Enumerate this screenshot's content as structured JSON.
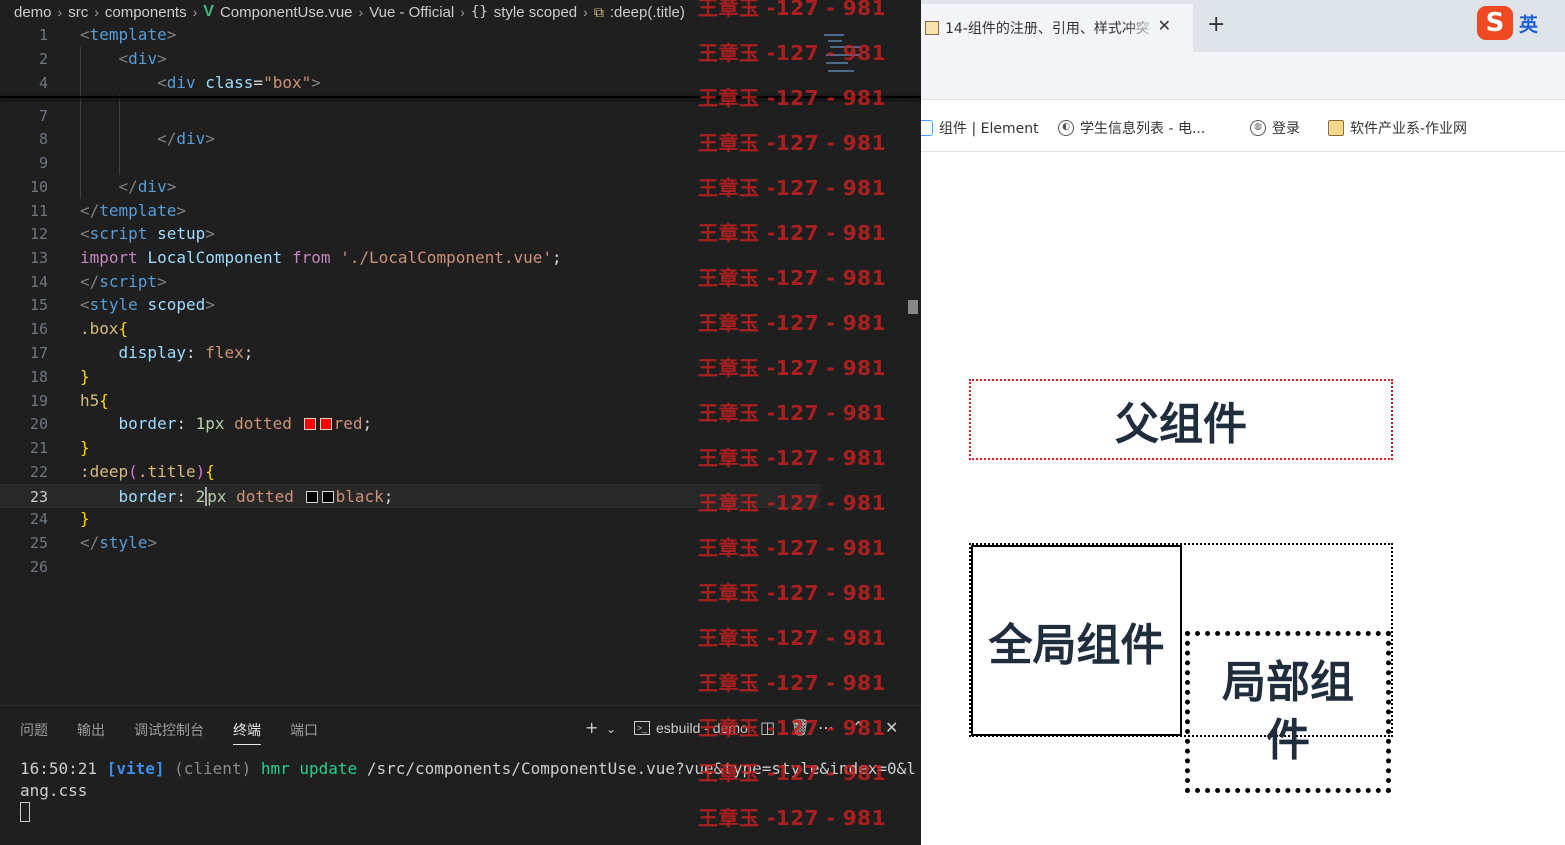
{
  "breadcrumb": [
    "demo",
    "src",
    "components",
    "ComponentUse.vue",
    "Vue - Official",
    "style scoped",
    ":deep(.title)"
  ],
  "code_lines": [
    {
      "n": "1",
      "html": "<span class='tag'>&lt;</span><span class='tn'>template</span><span class='tag'>&gt;</span>"
    },
    {
      "n": "2",
      "html": "    <span class='tag'>&lt;</span><span class='tn'>div</span><span class='tag'>&gt;</span>"
    },
    {
      "n": "4",
      "html": "        <span class='tag'>&lt;</span><span class='tn'>div</span> <span class='attr'>class</span>=<span class='str'>\"box\"</span><span class='tag'>&gt;</span>"
    },
    {
      "n": "7",
      "html": ""
    },
    {
      "n": "8",
      "html": "        <span class='tag'>&lt;/</span><span class='tn'>div</span><span class='tag'>&gt;</span>"
    },
    {
      "n": "9",
      "html": ""
    },
    {
      "n": "10",
      "html": "    <span class='tag'>&lt;/</span><span class='tn'>div</span><span class='tag'>&gt;</span>"
    },
    {
      "n": "11",
      "html": "<span class='tag'>&lt;/</span><span class='tn'>template</span><span class='tag'>&gt;</span>"
    },
    {
      "n": "12",
      "html": "<span class='tag'>&lt;</span><span class='tn'>script</span> <span class='attr'>setup</span><span class='tag'>&gt;</span>"
    },
    {
      "n": "13",
      "html": "<span class='kw'>import</span> <span class='id'>LocalComponent</span> <span class='kw'>from</span> <span class='str'>'./LocalComponent.vue'</span>;"
    },
    {
      "n": "14",
      "html": "<span class='tag'>&lt;/</span><span class='tn'>script</span><span class='tag'>&gt;</span>"
    },
    {
      "n": "15",
      "html": "<span class='tag'>&lt;</span><span class='tn'>style</span> <span class='attr'>scoped</span><span class='tag'>&gt;</span>"
    },
    {
      "n": "16",
      "html": "<span class='sel'>.box</span><span class='brace'>{</span>"
    },
    {
      "n": "17",
      "html": "    <span class='prop'>display</span>: <span class='val'>flex</span>;"
    },
    {
      "n": "18",
      "html": "<span class='brace'>}</span>"
    },
    {
      "n": "19",
      "html": "<span class='sel'>h5</span><span class='brace'>{</span>"
    },
    {
      "n": "20",
      "html": "    <span class='prop'>border</span>: <span class='num'>1px</span> <span class='val'>dotted</span> <span class='swatch' style='background:#ff0000'></span><span class='swatch' style='background:#ff0000'></span><span class='val'>red</span>;"
    },
    {
      "n": "21",
      "html": "<span class='brace'>}</span>"
    },
    {
      "n": "22",
      "html": "<span class='sel'>:deep</span><span class='brace2'>(</span><span class='sel'>.title</span><span class='brace2'>)</span><span class='brace'>{</span>"
    },
    {
      "n": "23",
      "html": "    <span class='prop'>border</span>: <span class='num'>2<span class='cursor'></span>px</span> <span class='val'>dotted</span> <span class='swatch' style='background:#000000'></span><span class='swatch' style='background:#000000'></span><span class='val'>black</span>;",
      "active": true
    },
    {
      "n": "24",
      "html": "<span class='brace'>}</span>"
    },
    {
      "n": "25",
      "html": "<span class='tag'>&lt;/</span><span class='tn'>style</span><span class='tag'>&gt;</span>"
    },
    {
      "n": "26",
      "html": ""
    }
  ],
  "watermark": {
    "text": "王章玉 -127 - 981",
    "color": "#cd2020",
    "rows": 19
  },
  "panel": {
    "tabs": [
      "问题",
      "输出",
      "调试控制台",
      "终端",
      "端口"
    ],
    "active_tab": "终端",
    "terminal_name": "esbuild - demo",
    "terminal_line": {
      "time": "16:50:21",
      "tag": "[vite]",
      "client": "(client)",
      "hmr": "hmr update",
      "path": "/src/components/ComponentUse.vue?vue&type=style&index=0&lang.css"
    }
  },
  "browser": {
    "tab_title": "14-组件的注册、引用、样式冲突",
    "ime_lang": "英",
    "ime_logo": "S",
    "bookmarks": [
      "组件 | Element",
      "学生信息列表 - 电...",
      "登录",
      "软件产业系-作业网"
    ],
    "page": {
      "parent_label": "父组件",
      "global_label": "全局组件",
      "local_label": "局部组件"
    }
  },
  "colors": {
    "editor_bg": "#1f1f1f",
    "watermark": "#cd2020",
    "parent_border": "#e02020",
    "heading_text": "#1f2d3d"
  }
}
